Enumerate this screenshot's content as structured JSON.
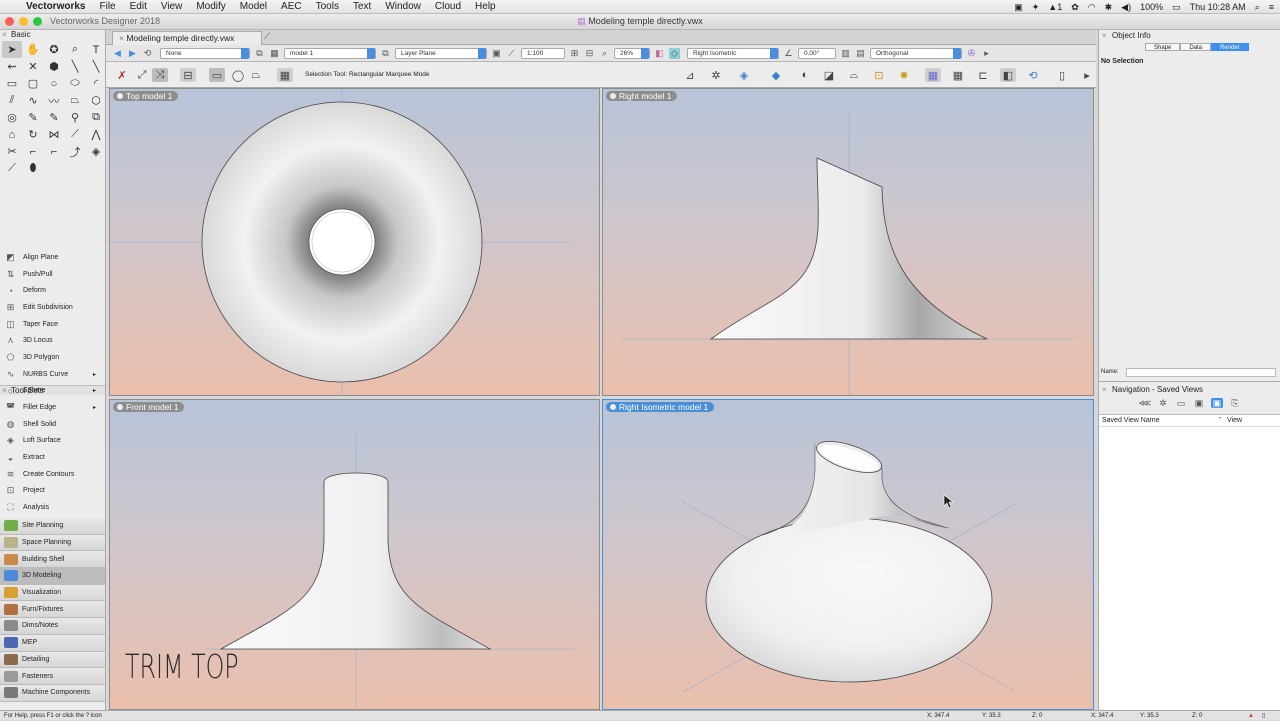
{
  "menubar": {
    "apple": "",
    "items": [
      "Vectorworks",
      "File",
      "Edit",
      "View",
      "Modify",
      "Model",
      "AEC",
      "Tools",
      "Text",
      "Window",
      "Cloud",
      "Help"
    ],
    "status": {
      "adobe": "1",
      "battery": "100%",
      "clock": "Thu 10:28 AM"
    }
  },
  "window": {
    "app_title": "Vectorworks Designer 2018",
    "doc_title": "Modeling temple directly.vwx"
  },
  "tabs": [
    {
      "label": "Modeling temple directly.vwx"
    }
  ],
  "viewbar": {
    "class": "None",
    "layer": "model 1",
    "plane": "Layer Plane",
    "scale": "1:100",
    "zoom": "26%",
    "view": "Right Isometric",
    "angle": "0.00°",
    "projection": "Orthogonal"
  },
  "modebar": {
    "hint": "Selection Tool: Rectangular Marquee Mode"
  },
  "palette": {
    "basic_title": "Basic",
    "toolsets_title": "Tool Sets",
    "tool_list": [
      {
        "label": "Align Plane",
        "arrow": ""
      },
      {
        "label": "Push/Pull",
        "arrow": ""
      },
      {
        "label": "Deform",
        "arrow": ""
      },
      {
        "label": "Edit Subdivision",
        "arrow": ""
      },
      {
        "label": "Taper Face",
        "arrow": ""
      },
      {
        "label": "3D Locus",
        "arrow": ""
      },
      {
        "label": "3D Polygon",
        "arrow": ""
      },
      {
        "label": "NURBS Curve",
        "arrow": "▸"
      },
      {
        "label": "Sphere",
        "arrow": "▸"
      },
      {
        "label": "Fillet Edge",
        "arrow": "▸"
      },
      {
        "label": "Shell Solid",
        "arrow": ""
      },
      {
        "label": "Loft Surface",
        "arrow": ""
      },
      {
        "label": "Extract",
        "arrow": ""
      },
      {
        "label": "Create Contours",
        "arrow": ""
      },
      {
        "label": "Project",
        "arrow": ""
      },
      {
        "label": "Analysis",
        "arrow": ""
      }
    ],
    "toolsets": [
      {
        "label": "Site Planning",
        "color": "#6fae4b"
      },
      {
        "label": "Space Planning",
        "color": "#bcb28a"
      },
      {
        "label": "Building Shell",
        "color": "#c98a4a"
      },
      {
        "label": "3D Modeling",
        "color": "#4a8ad6"
      },
      {
        "label": "Visualization",
        "color": "#d8a030"
      },
      {
        "label": "Furn/Fixtures",
        "color": "#b07040"
      },
      {
        "label": "Dims/Notes",
        "color": "#8a8a8a"
      },
      {
        "label": "MEP",
        "color": "#4a6ab0"
      },
      {
        "label": "Detailing",
        "color": "#8a6a4a"
      },
      {
        "label": "Fasteners",
        "color": "#9a9a9a"
      },
      {
        "label": "Machine Components",
        "color": "#7a7a7a"
      }
    ]
  },
  "viewports": {
    "top": "Top  model 1",
    "right": "Right  model 1",
    "front": "Front  model 1",
    "iso": "Right Isometric  model 1",
    "overlay_text": "TRIM TOP"
  },
  "object_info": {
    "title": "Object Info",
    "tabs": [
      "Shape",
      "Data",
      "Render"
    ],
    "selected_tab": "Render",
    "no_selection": "No Selection",
    "name_label": "Name:"
  },
  "navigation": {
    "title": "Navigation - Saved Views",
    "col_name": "Saved View Name",
    "col_view": "View"
  },
  "statusbar": {
    "help": "For Help, press F1 or click the ? icon",
    "x1": "X: 347.4",
    "y1": "Y: 35.3",
    "z1": "Z: 0",
    "x2": "X: 347.4",
    "y2": "Y: 35.3",
    "z2": "Z: 0"
  },
  "colors": {
    "accent": "#3d8ff2",
    "viewport_top": "#b8c4d8",
    "viewport_bottom": "#ebbfac"
  }
}
